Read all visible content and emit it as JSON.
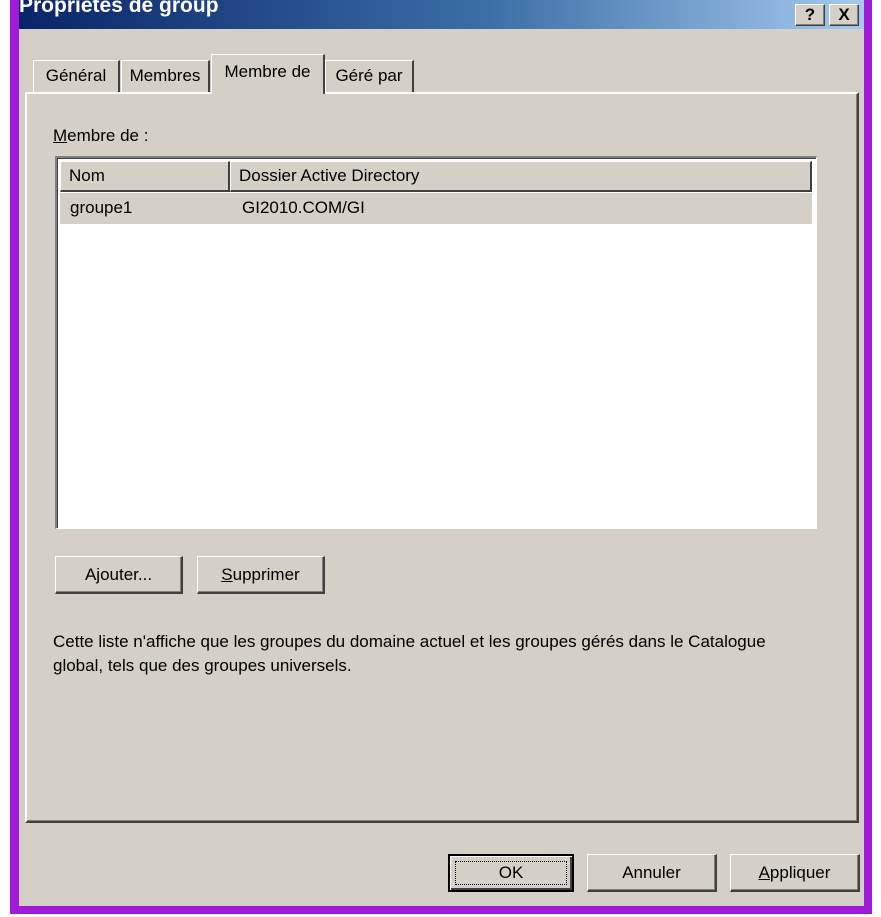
{
  "window": {
    "title": "Propriétés de group",
    "help_button": "?",
    "close_button": "X"
  },
  "tabs": [
    {
      "label": "Général",
      "active": false
    },
    {
      "label": "Membres",
      "active": false
    },
    {
      "label": "Membre de",
      "active": true
    },
    {
      "label": "Géré par",
      "active": false
    }
  ],
  "member_of": {
    "label_accel": "M",
    "label_rest": "embre de :",
    "columns": [
      "Nom",
      "Dossier Active Directory"
    ],
    "rows": [
      {
        "name": "groupe1",
        "folder": "GI2010.COM/GI"
      }
    ]
  },
  "actions": {
    "add_pre": "A",
    "add_accel": "j",
    "add_post": "outer...",
    "remove_accel": "S",
    "remove_post": "upprimer"
  },
  "info": {
    "text": "Cette liste n'affiche que les groupes du domaine actuel et les groupes gérés dans le Catalogue global, tels que des groupes universels."
  },
  "footer": {
    "ok_label": "OK",
    "cancel_label": "Annuler",
    "apply_accel": "A",
    "apply_post": "ppliquer"
  },
  "colors": {
    "border_accent": "#9f1bd8",
    "dialog_background": "#d4d0c8",
    "titlebar_start": "#0a246a",
    "titlebar_end": "#a6caf0",
    "selected_row": "#d4d0c8"
  }
}
